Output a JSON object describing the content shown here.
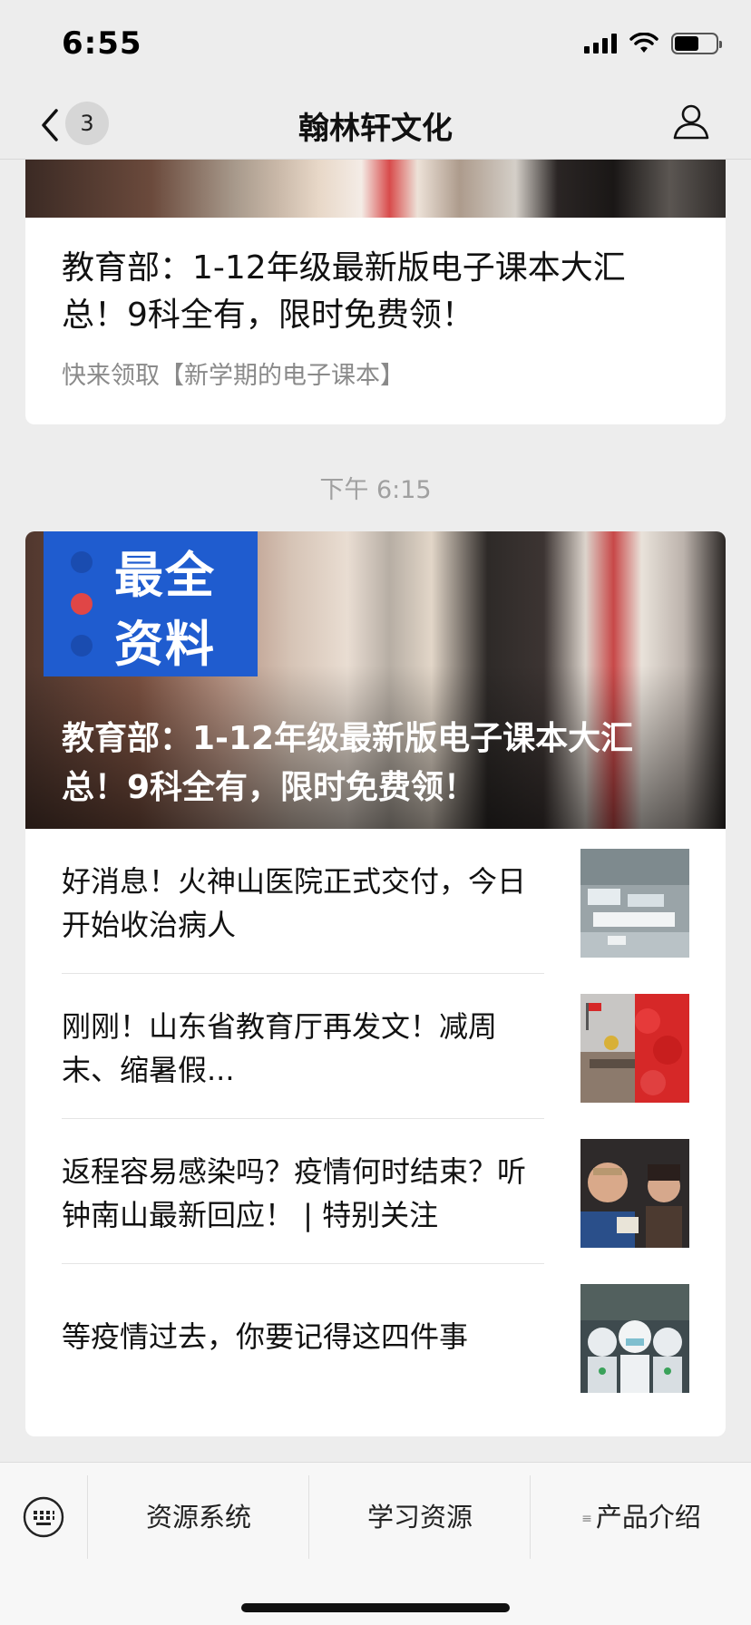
{
  "status_bar": {
    "time": "6:55"
  },
  "nav": {
    "badge": "3",
    "title": "翰林轩文化"
  },
  "top_card": {
    "title": "教育部：1-12年级最新版电子课本大汇总！9科全有，限时免费领！",
    "subtitle": "快来领取【新学期的电子课本】"
  },
  "timestamp": "下午 6:15",
  "main_card": {
    "hero_label": [
      "最全",
      "资料"
    ],
    "hero_title": "教育部：1-12年级最新版电子课本大汇总！9科全有，限时免费领！",
    "items": [
      {
        "title": "好消息！火神山医院正式交付，今日开始收治病人"
      },
      {
        "title": "刚刚！山东省教育厅再发文！减周末、缩暑假..."
      },
      {
        "title": "返程容易感染吗？疫情何时结束？听钟南山最新回应！ | 特别关注"
      },
      {
        "title": "等疫情过去，你要记得这四件事"
      }
    ]
  },
  "bottom_menu": {
    "items": [
      "资源系统",
      "学习资源",
      "产品介绍"
    ]
  }
}
